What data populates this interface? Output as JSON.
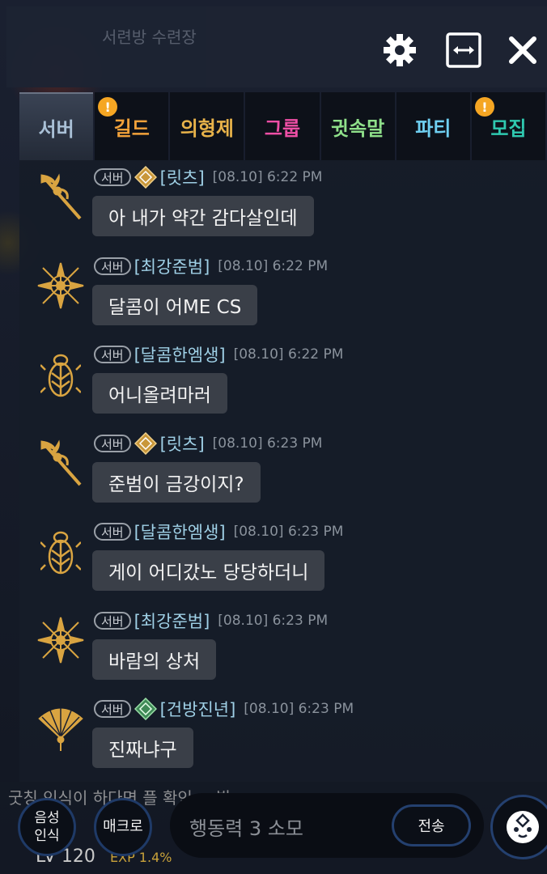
{
  "colors": {
    "accent_gold": "#d9a441",
    "name_color": "#9fd0e6",
    "bubble_bg": "#3a3f48",
    "alert_orange": "#f5a623"
  },
  "header": {
    "background_text": "서련방 수련장",
    "icons": [
      "gear-icon",
      "expand-horizontal-icon",
      "close-icon"
    ]
  },
  "tabs": [
    {
      "label": "서버",
      "color": "#a9c0d6",
      "active": true,
      "alert": false
    },
    {
      "label": "길드",
      "color": "#f2a23a",
      "active": false,
      "alert": true
    },
    {
      "label": "의형제",
      "color": "#e8b34a",
      "active": false,
      "alert": false
    },
    {
      "label": "그룹",
      "color": "#ef4fa6",
      "active": false,
      "alert": false
    },
    {
      "label": "귓속말",
      "color": "#8fe08a",
      "active": false,
      "alert": false
    },
    {
      "label": "파티",
      "color": "#6fd0f2",
      "active": false,
      "alert": false
    },
    {
      "label": "모집",
      "color": "#2fc9b0",
      "active": false,
      "alert": true
    }
  ],
  "alert_mark": "!",
  "messages": [
    {
      "channel": "서버",
      "badge": "gold",
      "avatar": "staff-icon",
      "name": "[릿츠]",
      "time": "[08.10] 6:22 PM",
      "text": "아 내가 약간 감다살인데"
    },
    {
      "channel": "서버",
      "badge": "",
      "avatar": "compass-rose-icon",
      "name": "[최강준범]",
      "time": "[08.10] 6:22 PM",
      "text": "달콤이 어ME CS"
    },
    {
      "channel": "서버",
      "badge": "",
      "avatar": "beetle-emblem-icon",
      "name": "[달콤한엠생]",
      "time": "[08.10] 6:22 PM",
      "text": "어니올려마러"
    },
    {
      "channel": "서버",
      "badge": "gold",
      "avatar": "staff-icon",
      "name": "[릿츠]",
      "time": "[08.10] 6:23 PM",
      "text": "준범이 금강이지?"
    },
    {
      "channel": "서버",
      "badge": "",
      "avatar": "beetle-emblem-icon",
      "name": "[달콤한엠생]",
      "time": "[08.10] 6:23 PM",
      "text": "게이 어디갔노 당당하더니"
    },
    {
      "channel": "서버",
      "badge": "",
      "avatar": "compass-rose-icon",
      "name": "[최강준범]",
      "time": "[08.10] 6:23 PM",
      "text": "바람의 상처"
    },
    {
      "channel": "서버",
      "badge": "green",
      "avatar": "fan-icon",
      "name": "[건방진년]",
      "time": "[08.10] 6:23 PM",
      "text": "진짜냐구"
    }
  ],
  "bottom": {
    "background_text": "굿칭 인식이 하다면 플 확인 ~ 발",
    "level": "LV 120",
    "exp": "EXP 1.4%",
    "voice_label": "음성\n인식",
    "macro_label": "매크로",
    "input_placeholder": "행동력 3 소모",
    "send_label": "전송"
  }
}
